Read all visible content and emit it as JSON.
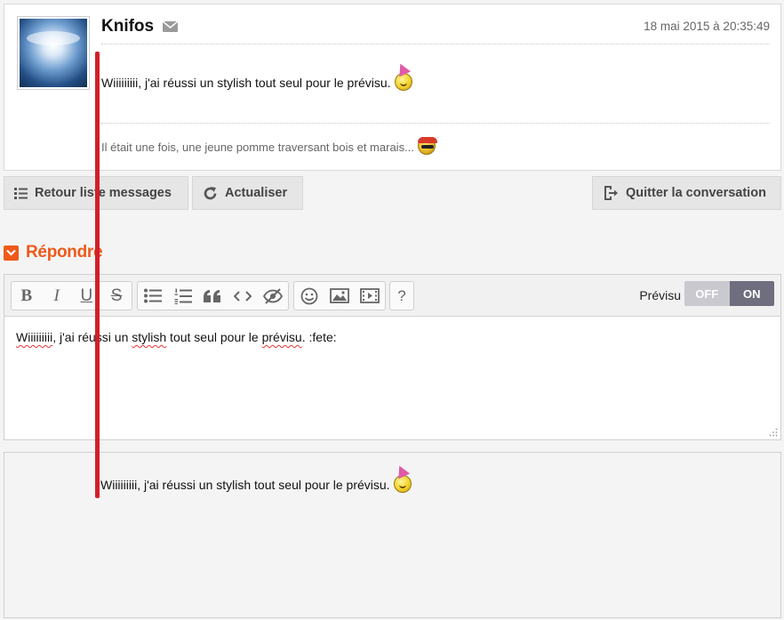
{
  "post": {
    "username": "Knifos",
    "date": "18 mai 2015 à 20:35:49",
    "body": "Wiiiiiiiii, j'ai réussi un stylish tout seul pour le prévisu.",
    "signature": "Il était une fois, une jeune pomme traversant bois et marais...",
    "icons": {
      "avatar": "angel-avatar",
      "mail": "mail-icon",
      "body_smiley": "party-smiley-icon",
      "signature_smiley": "pirate-smiley-icon"
    }
  },
  "actions": {
    "back_label": "Retour liste messages",
    "refresh_label": "Actualiser",
    "quit_label": "Quitter la conversation"
  },
  "reply": {
    "title": "Répondre"
  },
  "editor": {
    "toolbar": {
      "bold": "B",
      "italic": "I",
      "underline": "U",
      "strike": "S",
      "help": "?"
    },
    "preview_label": "Prévisu",
    "toggle_off": "OFF",
    "toggle_on": "ON",
    "text_parts": [
      "Wiiiiiiiii",
      ", j'ai ré",
      "ussi un ",
      "stylish",
      " tout seul pour le ",
      "prévisu",
      ". :fete:"
    ]
  },
  "preview": {
    "body": "Wiiiiiiiii, j'ai réussi un stylish tout seul pour le prévisu."
  },
  "colors": {
    "accent": "#ee5a1a",
    "annotation_line": "#d21f2a",
    "toggle_on": "#6f6e7f",
    "toggle_off": "#c9c9cf"
  }
}
